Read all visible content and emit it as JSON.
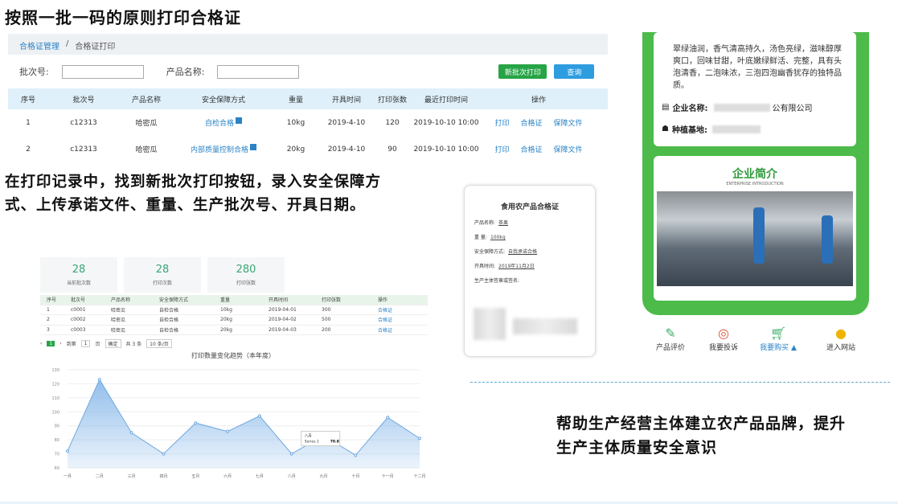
{
  "heading": "按照一批一码的原则打印合格证",
  "left_text": "在打印记录中，找到新批次打印按钮，录入安全保障方式、上传承诺文件、重量、生产批次号、开具日期。",
  "right_text": "帮助生产经营主体建立农产品品牌，提升生产主体质量安全意识",
  "panel1": {
    "breadcrumb": [
      "合格证管理",
      "/",
      "合格证打印"
    ],
    "batch_label": "批次号:",
    "product_label": "产品名称:",
    "new_batch_btn": "新批次打印",
    "query_btn": "查询",
    "headers": [
      "序号",
      "批次号",
      "产品名称",
      "安全保障方式",
      "重量",
      "开具时间",
      "打印张数",
      "最近打印时间",
      "操作"
    ],
    "rows": [
      {
        "no": "1",
        "batch": "c12313",
        "product": "哈密瓜",
        "method": "自检合格",
        "weight": "10kg",
        "date": "2019-4-10",
        "count": "120",
        "last": "2019-10-10 10:00",
        "a1": "打印",
        "a2": "合格证",
        "a3": "保障文件"
      },
      {
        "no": "2",
        "batch": "c12313",
        "product": "哈密瓜",
        "method": "内部质量控制合格",
        "weight": "20kg",
        "date": "2019-4-10",
        "count": "90",
        "last": "2019-10-10 10:00",
        "a1": "打印",
        "a2": "合格证",
        "a3": "保障文件"
      }
    ]
  },
  "panel2": {
    "stats": [
      {
        "n": "28",
        "t": "当前批次数"
      },
      {
        "n": "28",
        "t": "打印次数"
      },
      {
        "n": "280",
        "t": "打印张数"
      }
    ],
    "headers": [
      "序号",
      "批次号",
      "产品名称",
      "安全保障方式",
      "重量",
      "开具时间",
      "打印张数",
      "操作"
    ],
    "rows": [
      [
        "1",
        "c0001",
        "哈密瓜",
        "自检合格",
        "10kg",
        "2019-04-01",
        "300",
        "合格证"
      ],
      [
        "2",
        "c0002",
        "哈密瓜",
        "自检合格",
        "20kg",
        "2019-04-02",
        "500",
        "合格证"
      ],
      [
        "3",
        "c0003",
        "哈密瓜",
        "自检合格",
        "20kg",
        "2019-04-03",
        "200",
        "合格证"
      ]
    ],
    "pager": [
      "1",
      "到第",
      "1",
      "页",
      "确定",
      "共 3 条",
      "10 条/页"
    ]
  },
  "chart_data": {
    "type": "area",
    "title": "打印数量变化趋势（本年度）",
    "categories": [
      "一月",
      "二月",
      "三月",
      "四月",
      "五月",
      "六月",
      "七月",
      "八月",
      "九月",
      "十月",
      "十一月",
      "十二月"
    ],
    "values": [
      72,
      123,
      85,
      70,
      92,
      86,
      97,
      70,
      83,
      69,
      96,
      81
    ],
    "ylim": [
      60,
      130
    ],
    "yticks": [
      "130",
      "120",
      "110",
      "100",
      "90",
      "80",
      "70",
      "60"
    ],
    "tooltip": {
      "month": "八月",
      "series": "Series 1",
      "value": "70.8"
    },
    "color": "#7fb3e8"
  },
  "certificate": {
    "title": "食用农产品合格证",
    "lines": [
      {
        "k": "产品名称:",
        "v": "茶果"
      },
      {
        "k": "重 量:",
        "v": "100kg"
      },
      {
        "k": "安全保障方式:",
        "v": "自我承诺合格"
      },
      {
        "k": "开具时间:",
        "v": "2019年11月2日"
      },
      {
        "k": "生产主体签章或签名:",
        "v": ""
      }
    ]
  },
  "phone": {
    "desc": "翠绿油润，香气清高持久，汤色亮绿，滋味醇厚爽口，回味甘甜，叶底嫩绿鲜活、完整，具有头泡清香，二泡味浓，三泡四泡幽香犹存的独特品质。",
    "company_label": "企业名称:",
    "company_tail": "公有限公司",
    "base_label": "种植基地:",
    "intro_title": "企业简介",
    "intro_sub": "ENTERPRISE INTRODUCTION",
    "nav": [
      {
        "icon": "edit-icon",
        "label": "产品评价"
      },
      {
        "icon": "headset-icon",
        "label": "我要投诉"
      },
      {
        "icon": "cart-icon",
        "label": "我要购买 ▲"
      },
      {
        "icon": "location-icon",
        "label": "进入网站"
      }
    ]
  }
}
